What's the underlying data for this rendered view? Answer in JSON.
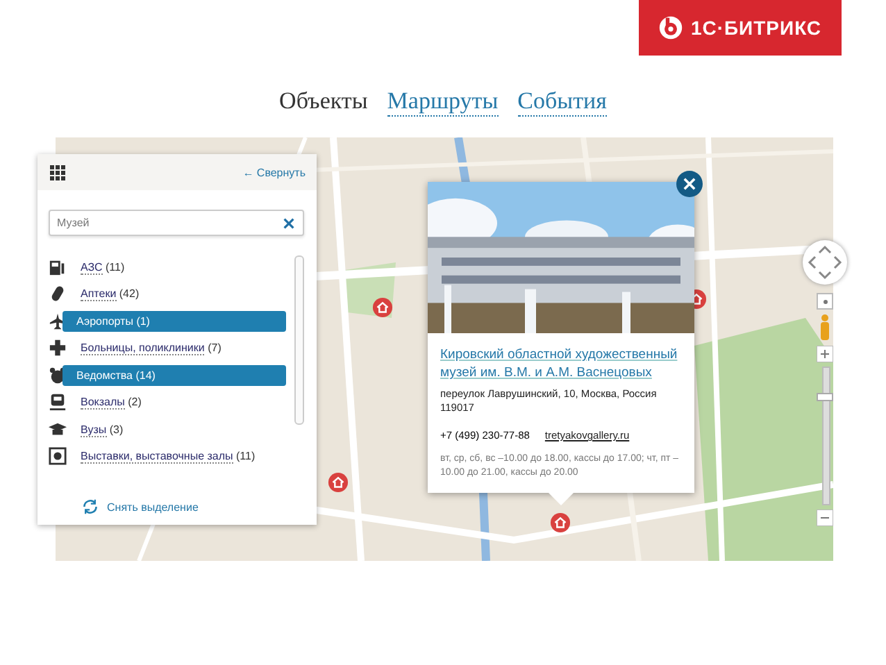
{
  "logo": {
    "text": "1С·БИТРИКС"
  },
  "tabs": [
    {
      "label": "Объекты",
      "selected": true
    },
    {
      "label": "Маршруты",
      "selected": false
    },
    {
      "label": "События",
      "selected": false
    }
  ],
  "map": {
    "kind": "picture",
    "zoom": {
      "level": 0.8
    }
  },
  "panel": {
    "collapse": "← Свернуть",
    "search": {
      "value": "Музей"
    },
    "categories": [
      {
        "name": "АЗС",
        "count": "(11)",
        "selected": false
      },
      {
        "name": "Аптеки",
        "count": "(42)",
        "selected": false
      },
      {
        "name": "Аэропорты",
        "count": "(1)",
        "selected": true
      },
      {
        "name": "Больницы, поликлиники",
        "count": "(7)",
        "selected": false
      },
      {
        "name": "Ведомства",
        "count": "(14)",
        "selected": true
      },
      {
        "name": "Вокзалы",
        "count": "(2)",
        "selected": false
      },
      {
        "name": "Вузы",
        "count": "(3)",
        "selected": false
      },
      {
        "name": "Выставки, выставочные залы",
        "count": "(11)",
        "selected": false
      }
    ],
    "reset": "Снять выделение"
  },
  "popup": {
    "title": "Кировский областной художественный музей им. В.М. и А.М. Васнецовых",
    "address": "переулок Лаврушинский, 10, Москва, Россия 119017",
    "phone": "+7 (499) 230-77-88",
    "website": "tretyakovgallery.ru",
    "hours": "вт, ср, сб, вс –10.00 до 18.00, кассы до 17.00; чт, пт – 10.00 до 21.00, кассы до 20.00"
  }
}
